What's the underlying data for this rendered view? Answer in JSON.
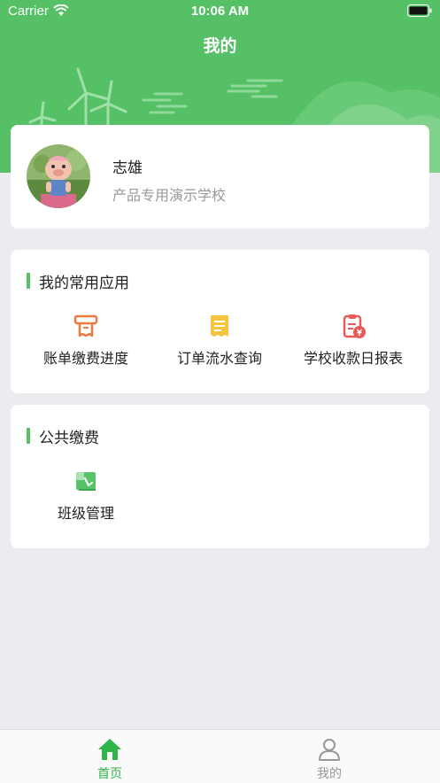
{
  "status_bar": {
    "carrier": "Carrier",
    "time": "10:06 AM"
  },
  "header": {
    "title": "我的"
  },
  "profile": {
    "name": "志雄",
    "school": "产品专用演示学校",
    "avatar_icon": "avatar-pig-icon"
  },
  "common_apps": {
    "title": "我的常用应用",
    "items": [
      {
        "label": "账单缴费进度",
        "icon": "bill-progress-icon"
      },
      {
        "label": "订单流水查询",
        "icon": "order-list-icon"
      },
      {
        "label": "学校收款日报表",
        "icon": "daily-report-icon"
      }
    ]
  },
  "public_fees": {
    "title": "公共缴费",
    "items": [
      {
        "label": "班级管理",
        "icon": "class-manage-icon"
      }
    ]
  },
  "tabbar": {
    "items": [
      {
        "label": "首页",
        "icon": "home-icon",
        "active": true
      },
      {
        "label": "我的",
        "icon": "person-icon",
        "active": false
      }
    ]
  },
  "colors": {
    "primary": "#55c065",
    "background": "#ebebf0",
    "inactive": "#999999"
  }
}
